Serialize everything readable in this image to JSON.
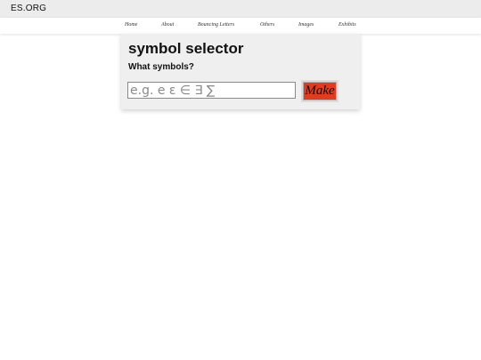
{
  "header": {
    "site_title": "ES.ORG"
  },
  "nav": {
    "items": [
      {
        "label": "Home"
      },
      {
        "label": "About"
      },
      {
        "label": "Bouncing Letters"
      },
      {
        "label": "Others"
      },
      {
        "label": "Images"
      },
      {
        "label": "Exhibits"
      }
    ]
  },
  "main": {
    "title": "symbol selector",
    "subtitle": "What symbols?",
    "input": {
      "value": "",
      "placeholder": "e.g. e ε ∈ ∃ ∑"
    },
    "button_label": "Make",
    "colors": {
      "button_bg": "#e63a1c",
      "card_bg": "#efefef"
    }
  }
}
